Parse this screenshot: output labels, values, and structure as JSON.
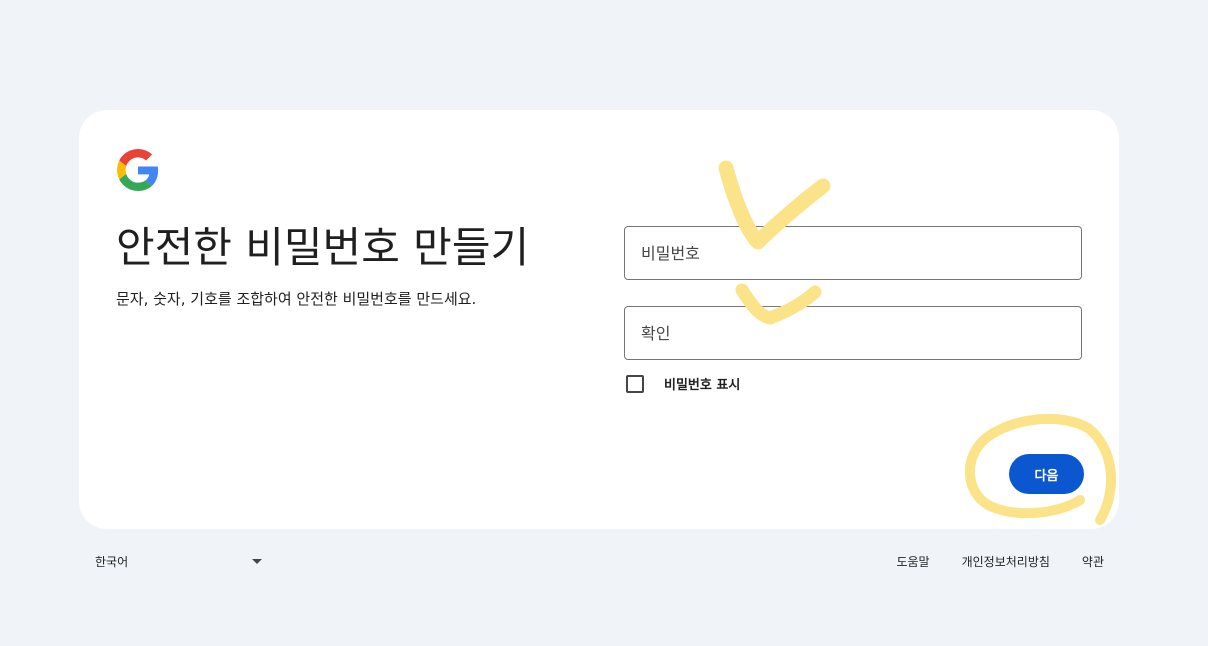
{
  "card": {
    "title": "안전한 비밀번호 만들기",
    "subtitle": "문자, 숫자, 기호를 조합하여 안전한 비밀번호를 만드세요."
  },
  "form": {
    "password_placeholder": "비밀번호",
    "password_value": "",
    "confirm_placeholder": "확인",
    "confirm_value": "",
    "show_password_label": "비밀번호 표시",
    "show_password_checked": false,
    "next_label": "다음"
  },
  "footer": {
    "language": "한국어",
    "links": [
      "도움말",
      "개인정보처리방침",
      "약관"
    ]
  },
  "icons": {
    "logo": "google-logo-icon",
    "language_dropdown": "caret-down-icon"
  },
  "colors": {
    "background": "#f0f4f9",
    "card": "#ffffff",
    "primary_button": "#0b57d0",
    "annotation_highlight": "#fbe38a"
  }
}
